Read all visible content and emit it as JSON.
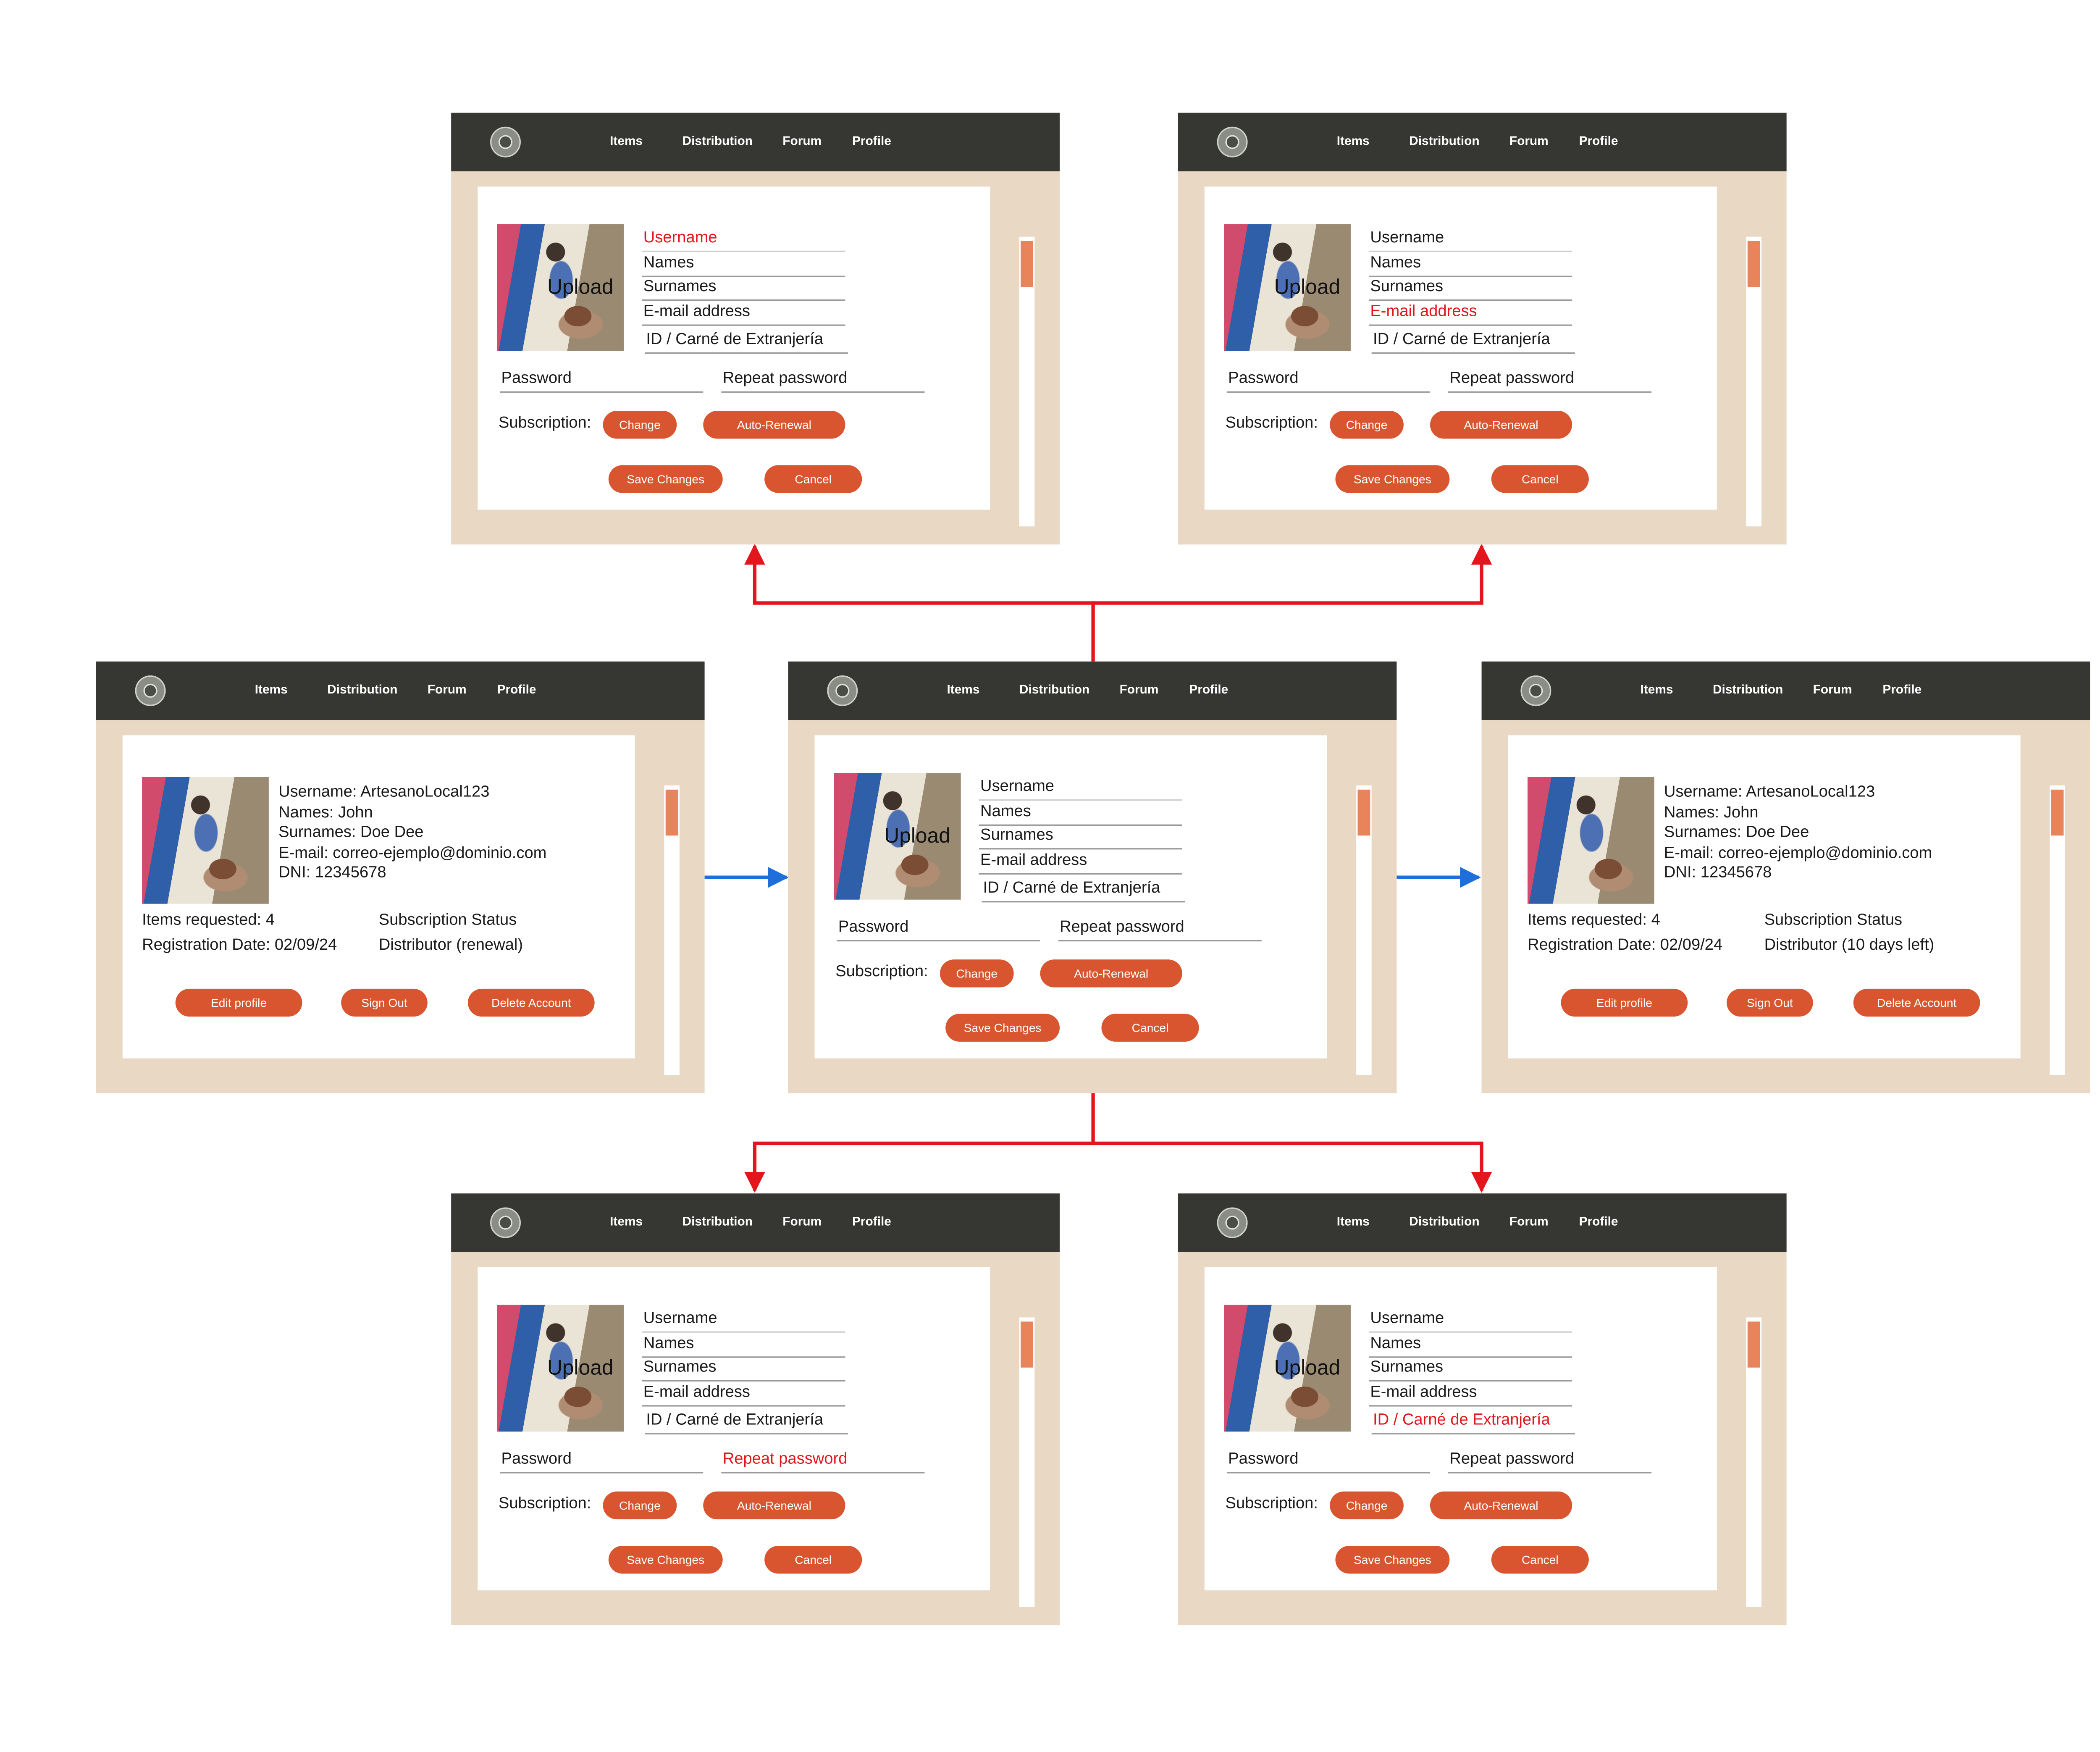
{
  "nav": {
    "logo": "emblem-logo",
    "items": [
      "Items",
      "Distribution",
      "Forum",
      "Profile"
    ]
  },
  "edit_form": {
    "upload_label": "Upload",
    "username": "Username",
    "names": "Names",
    "surnames": "Surnames",
    "email": "E-mail address",
    "id_doc": "ID / Carné de Extranjería",
    "password": "Password",
    "repeat_password": "Repeat password",
    "subscription_label": "Subscription:",
    "change_button": "Change",
    "auto_renewal_button": "Auto-Renewal",
    "save_button": "Save Changes",
    "cancel_button": "Cancel"
  },
  "profile_left": {
    "username_line": "Username: ArtesanoLocal123",
    "names_line": "Names: John",
    "surnames_line": "Surnames: Doe Dee",
    "email_line": "E-mail: correo-ejemplo@dominio.com",
    "dni_line": "DNI: 12345678",
    "items_requested": "Items requested: 4",
    "registration_date": "Registration Date: 02/09/24",
    "subscription_status_label": "Subscription Status",
    "subscription_status_value": "Distributor (renewal)",
    "edit_button": "Edit profile",
    "signout_button": "Sign Out",
    "delete_button": "Delete Account"
  },
  "profile_right": {
    "username_line": "Username: ArtesanoLocal123",
    "names_line": "Names: John",
    "surnames_line": "Surnames: Doe Dee",
    "email_line": "E-mail: correo-ejemplo@dominio.com",
    "dni_line": "DNI: 12345678",
    "items_requested": "Items requested: 4",
    "registration_date": "Registration Date: 02/09/24",
    "subscription_status_label": "Subscription Status",
    "subscription_status_value": "Distributor (10 days left)",
    "edit_button": "Edit profile",
    "signout_button": "Sign Out",
    "delete_button": "Delete Account"
  },
  "colors": {
    "navbar": "#363733",
    "frame": "#e8d8c4",
    "button": "#d8552f",
    "scroll_thumb": "#e8835a",
    "error_text": "#e3161d",
    "tree_arrow": "#e3161d",
    "flow_arrow": "#1e6fd9"
  }
}
